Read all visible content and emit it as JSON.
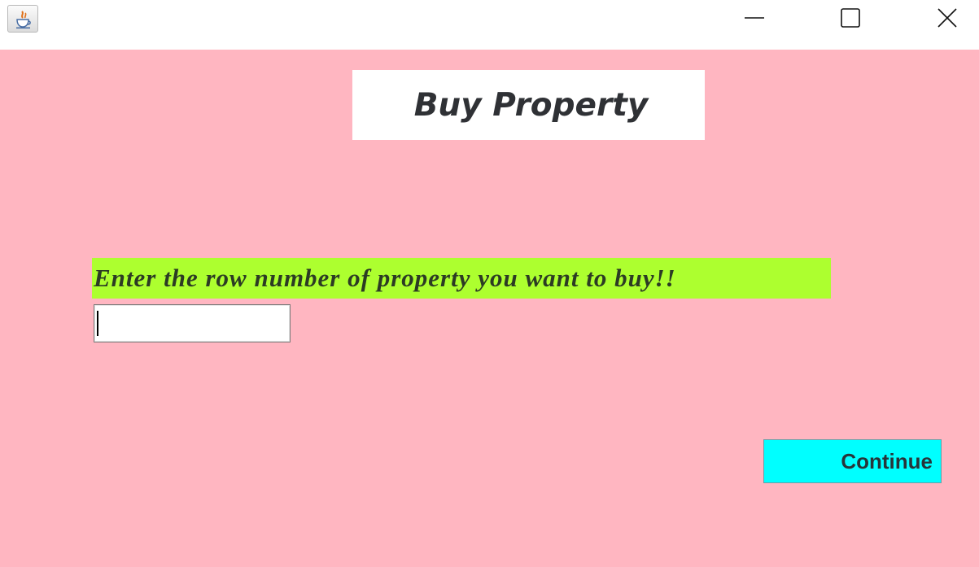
{
  "window": {
    "app_icon": "java-icon",
    "controls": {
      "minimize_icon": "minimize-icon",
      "maximize_icon": "maximize-icon",
      "close_icon": "close-icon"
    }
  },
  "main": {
    "title": "Buy Property",
    "prompt": "Enter the row number of property you want to buy!!",
    "row_input": {
      "value": "",
      "placeholder": ""
    },
    "continue_label": "Continue"
  },
  "colors": {
    "background": "#ffb6c1",
    "title_box": "#ffffff",
    "prompt_highlight": "#adff2f",
    "continue_button": "#00ffff"
  }
}
